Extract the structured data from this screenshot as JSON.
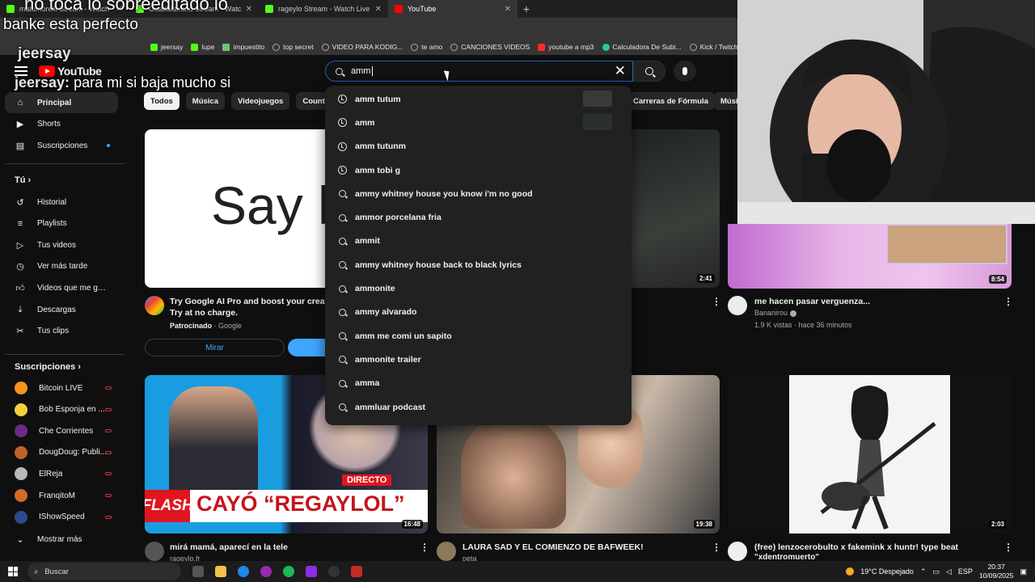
{
  "browser": {
    "tabs": [
      {
        "title": "matumorelli Stream - Watch",
        "active": false,
        "color": "#53fc18"
      },
      {
        "title": "Guadaltbrand Stream - Watch",
        "active": false,
        "color": "#53fc18"
      },
      {
        "title": "rageylo Stream - Watch Live",
        "active": false,
        "color": "#53fc18"
      },
      {
        "title": "YouTube",
        "active": true,
        "color": "#ff0000"
      }
    ],
    "bookmarks": [
      {
        "label": "jeersay",
        "icon": "kick-icon"
      },
      {
        "label": "lupe",
        "icon": "kick-icon"
      },
      {
        "label": "impuestito",
        "icon": "sheet-icon"
      },
      {
        "label": "top secret",
        "icon": "globe-icon"
      },
      {
        "label": "VIDEO PARA KODIG...",
        "icon": "globe-icon"
      },
      {
        "label": "te amo",
        "icon": "globe-icon"
      },
      {
        "label": "CANCIONES VIDEOS",
        "icon": "globe-icon"
      },
      {
        "label": "youtube a mp3",
        "icon": "youtube-icon"
      },
      {
        "label": "Calculadora De Subi...",
        "icon": "calculator-icon"
      },
      {
        "label": "Kick / Twitch VOD",
        "icon": "globe-icon"
      }
    ]
  },
  "overlay": {
    "line1": "no toca lo sobreeditado lo",
    "line2": "banke esta perfecto",
    "chat": [
      {
        "user": "jeersay",
        "msg": ""
      },
      {
        "user": "jeersay:",
        "msg": "para mi si baja mucho si"
      }
    ]
  },
  "header": {
    "logo": "YouTube",
    "search_query": "amm"
  },
  "suggestions": [
    {
      "text": "amm tutum",
      "type": "history",
      "thumb": "#3a3a3a"
    },
    {
      "text": "amm",
      "type": "history",
      "thumb": "#2a3030"
    },
    {
      "text": "amm tutunm",
      "type": "history"
    },
    {
      "text": "amm tobi g",
      "type": "history"
    },
    {
      "text": "ammy whitney house you know i'm no good",
      "type": "search"
    },
    {
      "text": "ammor porcelana fria",
      "type": "search"
    },
    {
      "text": "ammit",
      "type": "search"
    },
    {
      "text": "ammy whitney house back to black lyrics",
      "type": "search"
    },
    {
      "text": "ammonite",
      "type": "search"
    },
    {
      "text": "ammy alvarado",
      "type": "search"
    },
    {
      "text": "amm me comi un sapito",
      "type": "search"
    },
    {
      "text": "ammonite trailer",
      "type": "search"
    },
    {
      "text": "amma",
      "type": "search"
    },
    {
      "text": "ammluar podcast",
      "type": "search"
    }
  ],
  "sidebar": {
    "main": [
      {
        "label": "Principal",
        "icon": "home-icon",
        "active": true
      },
      {
        "label": "Shorts",
        "icon": "shorts-icon"
      },
      {
        "label": "Suscripciones",
        "icon": "subscriptions-icon",
        "dot": true
      }
    ],
    "you_title": "Tú",
    "you": [
      {
        "label": "Historial",
        "icon": "history-icon"
      },
      {
        "label": "Playlists",
        "icon": "playlist-icon"
      },
      {
        "label": "Tus videos",
        "icon": "video-icon"
      },
      {
        "label": "Ver más tarde",
        "icon": "clock-icon"
      },
      {
        "label": "Videos que me gus...",
        "icon": "like-icon"
      },
      {
        "label": "Descargas",
        "icon": "download-icon"
      },
      {
        "label": "Tus clips",
        "icon": "scissors-icon"
      }
    ],
    "subs_title": "Suscripciones",
    "subs": [
      {
        "label": "Bitcoin LIVE",
        "color": "#f7931a"
      },
      {
        "label": "Bob Esponja en ...",
        "color": "#f2d23a"
      },
      {
        "label": "Che Corrientes",
        "color": "#6a2a8a"
      },
      {
        "label": "DougDoug: Publi...",
        "color": "#c0632a"
      },
      {
        "label": "ElReja",
        "color": "#b9b9b9"
      },
      {
        "label": "FranqitoM",
        "color": "#d26a2a"
      },
      {
        "label": "IShowSpeed",
        "color": "#2a4a8a"
      }
    ],
    "more": "Mostrar más"
  },
  "chips": {
    "left": [
      "Todos",
      "Música",
      "Videojuegos",
      "Counter-"
    ],
    "right": [
      "Carreras de Fórmula",
      "Músi"
    ]
  },
  "videos": {
    "ad": {
      "thumb_text": "Say k",
      "title_line1": "Try Google AI Pro and boost your creativ",
      "title_line2": "Try at no charge.",
      "sponsor": "Patrocinado",
      "advertiser": "Google",
      "button": "Mirar"
    },
    "top_mid": {
      "duration": "2:41"
    },
    "top_right": {
      "title": "me hacen pasar verguenza...",
      "channel": "Bananirou",
      "meta": "1.9 K vistas · hace 36 minutos",
      "duration": "8:54"
    },
    "bottom": [
      {
        "title": "mirá mamá, aparecí en la tele",
        "channel": "rageylo.fr",
        "duration": "16:48",
        "flash": "FLASH",
        "headline": "CAYÓ “REGAYLOL”",
        "badge": "DIRECTO"
      },
      {
        "title": "LAURA SAD Y EL COMIENZO DE BAFWEEK!",
        "channel": "peta",
        "duration": "19:38"
      },
      {
        "title": "(free) lenzocerobulto x fakemink x huntr! type beat",
        "channel": "\"xdentromuerto\"",
        "duration": "2:03"
      }
    ]
  },
  "taskbar": {
    "search": "Buscar",
    "weather": "19°C  Despejado",
    "lang": "ESP",
    "time": "20:37",
    "date": "10/09/2025"
  }
}
